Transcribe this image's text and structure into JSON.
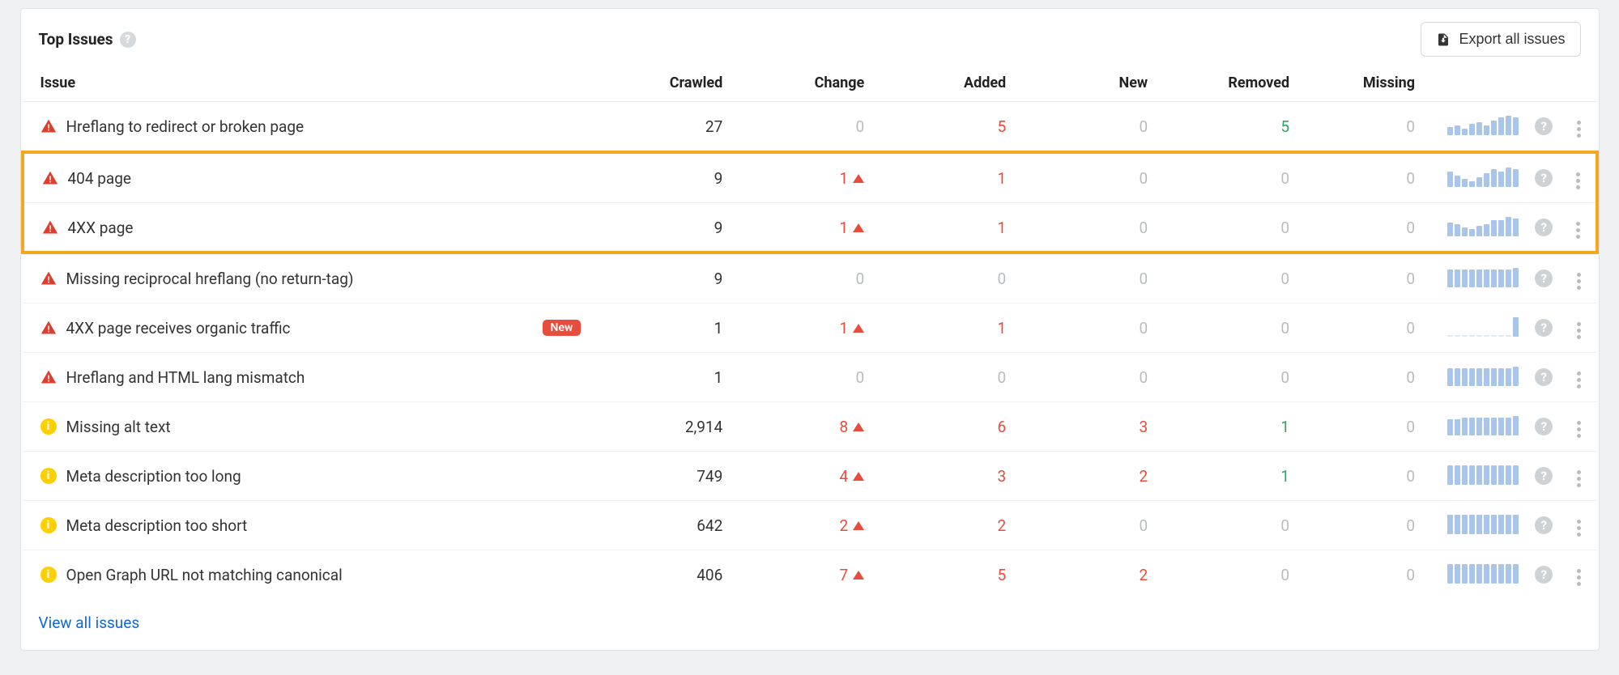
{
  "header": {
    "title": "Top Issues",
    "export_label": "Export all issues"
  },
  "columns": {
    "issue": "Issue",
    "crawled": "Crawled",
    "change": "Change",
    "added": "Added",
    "new": "New",
    "removed": "Removed",
    "missing": "Missing"
  },
  "footer": {
    "view_all": "View all issues"
  },
  "rows": [
    {
      "severity": "error",
      "label": "Hreflang to redirect or broken page",
      "badge": null,
      "crawled": "27",
      "change": {
        "value": "0",
        "direction": "none",
        "color": "muted"
      },
      "added": {
        "value": "5",
        "color": "red"
      },
      "new": {
        "value": "0",
        "color": "muted"
      },
      "removed": {
        "value": "5",
        "color": "green"
      },
      "missing": {
        "value": "0",
        "color": "muted"
      },
      "spark": [
        10,
        12,
        8,
        14,
        16,
        12,
        18,
        22,
        24,
        22
      ],
      "highlight": null
    },
    {
      "severity": "error",
      "label": "404 page",
      "badge": null,
      "crawled": "9",
      "change": {
        "value": "1",
        "direction": "up",
        "color": "red"
      },
      "added": {
        "value": "1",
        "color": "red"
      },
      "new": {
        "value": "0",
        "color": "muted"
      },
      "removed": {
        "value": "0",
        "color": "muted"
      },
      "missing": {
        "value": "0",
        "color": "muted"
      },
      "spark": [
        16,
        12,
        8,
        6,
        10,
        14,
        18,
        16,
        20,
        18
      ],
      "highlight": "top"
    },
    {
      "severity": "error",
      "label": "4XX page",
      "badge": null,
      "crawled": "9",
      "change": {
        "value": "1",
        "direction": "up",
        "color": "red"
      },
      "added": {
        "value": "1",
        "color": "red"
      },
      "new": {
        "value": "0",
        "color": "muted"
      },
      "removed": {
        "value": "0",
        "color": "muted"
      },
      "missing": {
        "value": "0",
        "color": "muted"
      },
      "spark": [
        16,
        14,
        10,
        8,
        12,
        14,
        18,
        18,
        22,
        20
      ],
      "highlight": "bottom"
    },
    {
      "severity": "error",
      "label": "Missing reciprocal hreflang (no return-tag)",
      "badge": null,
      "crawled": "9",
      "change": {
        "value": "0",
        "direction": "none",
        "color": "muted"
      },
      "added": {
        "value": "0",
        "color": "muted"
      },
      "new": {
        "value": "0",
        "color": "muted"
      },
      "removed": {
        "value": "0",
        "color": "muted"
      },
      "missing": {
        "value": "0",
        "color": "muted"
      },
      "spark": [
        22,
        22,
        22,
        22,
        22,
        22,
        22,
        22,
        22,
        24
      ],
      "highlight": null
    },
    {
      "severity": "error",
      "label": "4XX page receives organic traffic",
      "badge": "New",
      "crawled": "1",
      "change": {
        "value": "1",
        "direction": "up",
        "color": "red"
      },
      "added": {
        "value": "1",
        "color": "red"
      },
      "new": {
        "value": "0",
        "color": "muted"
      },
      "removed": {
        "value": "0",
        "color": "muted"
      },
      "missing": {
        "value": "0",
        "color": "muted"
      },
      "spark": [
        2,
        2,
        2,
        2,
        2,
        2,
        2,
        2,
        2,
        22
      ],
      "spark_style": "faint-last",
      "highlight": null
    },
    {
      "severity": "error",
      "label": "Hreflang and HTML lang mismatch",
      "badge": null,
      "crawled": "1",
      "change": {
        "value": "0",
        "direction": "none",
        "color": "muted"
      },
      "added": {
        "value": "0",
        "color": "muted"
      },
      "new": {
        "value": "0",
        "color": "muted"
      },
      "removed": {
        "value": "0",
        "color": "muted"
      },
      "missing": {
        "value": "0",
        "color": "muted"
      },
      "spark": [
        22,
        22,
        22,
        22,
        22,
        22,
        22,
        22,
        22,
        24
      ],
      "highlight": null
    },
    {
      "severity": "warning",
      "label": "Missing alt text",
      "badge": null,
      "crawled": "2,914",
      "change": {
        "value": "8",
        "direction": "up",
        "color": "red"
      },
      "added": {
        "value": "6",
        "color": "red"
      },
      "new": {
        "value": "3",
        "color": "red"
      },
      "removed": {
        "value": "1",
        "color": "green"
      },
      "missing": {
        "value": "0",
        "color": "muted"
      },
      "spark": [
        20,
        20,
        22,
        22,
        22,
        22,
        22,
        22,
        22,
        24
      ],
      "highlight": null
    },
    {
      "severity": "warning",
      "label": "Meta description too long",
      "badge": null,
      "crawled": "749",
      "change": {
        "value": "4",
        "direction": "up",
        "color": "red"
      },
      "added": {
        "value": "3",
        "color": "red"
      },
      "new": {
        "value": "2",
        "color": "red"
      },
      "removed": {
        "value": "1",
        "color": "green"
      },
      "missing": {
        "value": "0",
        "color": "muted"
      },
      "spark": [
        22,
        22,
        22,
        22,
        22,
        22,
        22,
        22,
        22,
        22
      ],
      "highlight": null
    },
    {
      "severity": "warning",
      "label": "Meta description too short",
      "badge": null,
      "crawled": "642",
      "change": {
        "value": "2",
        "direction": "up",
        "color": "red"
      },
      "added": {
        "value": "2",
        "color": "red"
      },
      "new": {
        "value": "0",
        "color": "muted"
      },
      "removed": {
        "value": "0",
        "color": "muted"
      },
      "missing": {
        "value": "0",
        "color": "muted"
      },
      "spark": [
        22,
        22,
        22,
        22,
        22,
        22,
        22,
        22,
        22,
        22
      ],
      "highlight": null
    },
    {
      "severity": "warning",
      "label": "Open Graph URL not matching canonical",
      "badge": null,
      "crawled": "406",
      "change": {
        "value": "7",
        "direction": "up",
        "color": "red"
      },
      "added": {
        "value": "5",
        "color": "red"
      },
      "new": {
        "value": "2",
        "color": "red"
      },
      "removed": {
        "value": "0",
        "color": "muted"
      },
      "missing": {
        "value": "0",
        "color": "muted"
      },
      "spark": [
        22,
        22,
        22,
        22,
        22,
        22,
        22,
        22,
        22,
        22
      ],
      "highlight": null
    }
  ]
}
